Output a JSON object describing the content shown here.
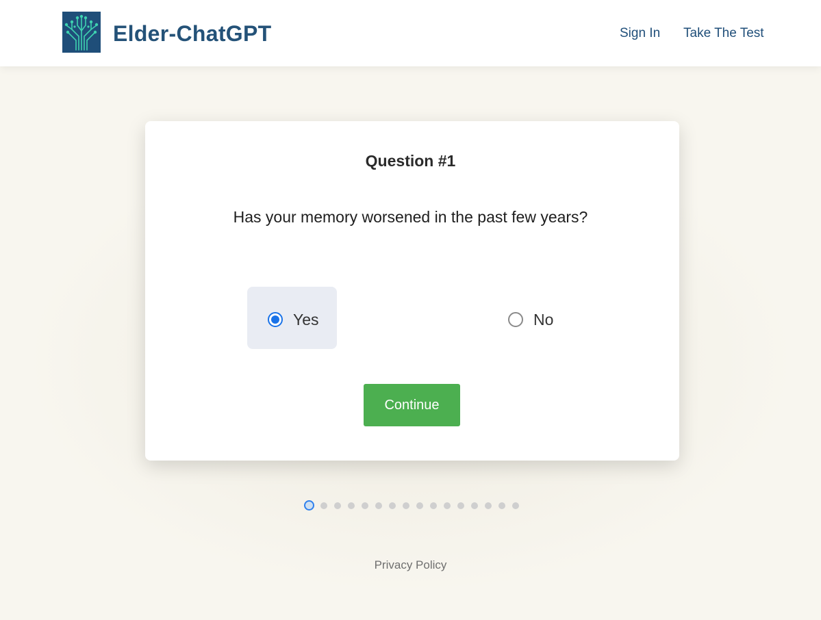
{
  "header": {
    "brand": "Elder-ChatGPT",
    "nav": [
      {
        "label": "Sign In"
      },
      {
        "label": "Take The Test"
      }
    ]
  },
  "question": {
    "title": "Question #1",
    "text": "Has your memory worsened in the past few years?",
    "options": [
      {
        "label": "Yes",
        "selected": true
      },
      {
        "label": "No",
        "selected": false
      }
    ],
    "continue_label": "Continue"
  },
  "progress": {
    "total_steps": 16,
    "current_step": 1
  },
  "footer": {
    "privacy_label": "Privacy Policy"
  },
  "colors": {
    "brand": "#245278",
    "accent": "#4caf50",
    "radio_selected": "#1a73e8"
  },
  "icons": {
    "logo": "circuit-tree-icon"
  }
}
